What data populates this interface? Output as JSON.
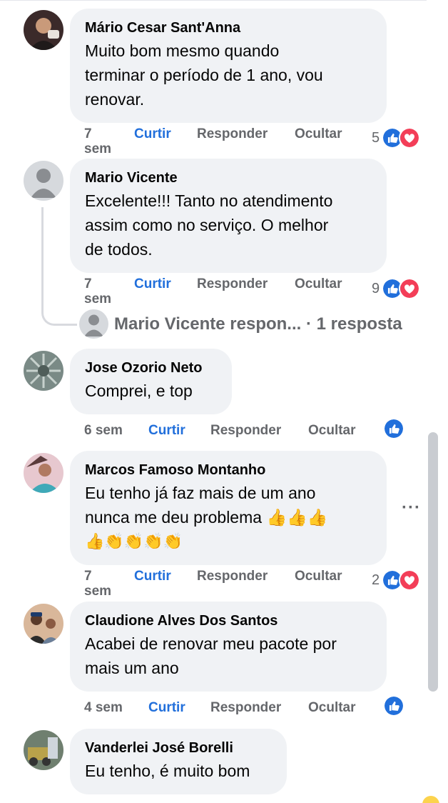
{
  "comments": [
    {
      "author": "Mário Cesar Sant'Anna",
      "lines": [
        "Muito bom mesmo quando",
        "terminar o período de 1 ano, vou",
        "renovar."
      ],
      "time_top": "7",
      "time_bottom": "sem",
      "like": "Curtir",
      "reply": "Responder",
      "hide": "Ocultar",
      "reaction_count": "5",
      "reactions": [
        "like-icon",
        "love-icon"
      ]
    },
    {
      "author": "Mario Vicente",
      "lines": [
        "Excelente!!! Tanto no atendimento",
        "assim como no serviço. O melhor",
        "de todos."
      ],
      "time_top": "7",
      "time_bottom": "sem",
      "like": "Curtir",
      "reply": "Responder",
      "hide": "Ocultar",
      "reaction_count": "9",
      "reactions": [
        "like-icon",
        "love-icon"
      ],
      "thread_reply": {
        "text": "Mario Vicente respon...",
        "count": "· 1 resposta"
      }
    },
    {
      "author": "Jose Ozorio Neto",
      "lines": [
        "Comprei, e top"
      ],
      "time": "6 sem",
      "like": "Curtir",
      "reply": "Responder",
      "hide": "Ocultar",
      "reaction_count": "",
      "reactions": [
        "like-icon"
      ]
    },
    {
      "author": "Marcos Famoso Montanho",
      "lines": [
        "Eu tenho já faz mais de um ano",
        "nunca me deu problema 👍👍👍",
        "👍👏👏👏👏"
      ],
      "time_top": "7",
      "time_bottom": "sem",
      "like": "Curtir",
      "reply": "Responder",
      "hide": "Ocultar",
      "reaction_count": "2",
      "reactions": [
        "like-icon",
        "love-icon"
      ],
      "more": "···"
    },
    {
      "author": "Claudione Alves Dos Santos",
      "lines": [
        "Acabei de renovar meu pacote por",
        "mais um ano"
      ],
      "time": "4 sem",
      "like": "Curtir",
      "reply": "Responder",
      "hide": "Ocultar",
      "reaction_count": "",
      "reactions": [
        "like-icon"
      ]
    },
    {
      "author": "Vanderlei José Borelli",
      "lines": [
        "Eu tenho, é muito bom"
      ]
    }
  ],
  "colors": {
    "like_blue": "#216fdb",
    "love_red": "#f33e58",
    "bubble_bg": "#f0f2f5",
    "meta_gray": "#65676b"
  }
}
